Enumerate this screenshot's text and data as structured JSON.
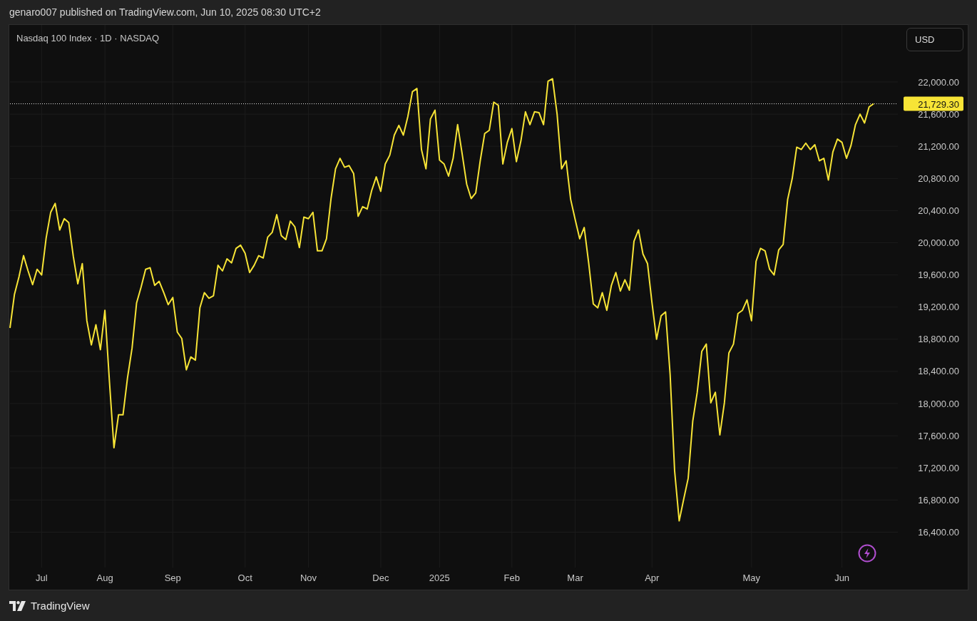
{
  "header": {
    "text": "genaro007 published on TradingView.com, Jun 10, 2025 08:30 UTC+2"
  },
  "chart": {
    "legend": "Nasdaq 100 Index · 1D · NASDAQ",
    "currency_button": "USD",
    "chart_data": {
      "type": "line",
      "categories": [
        null,
        null,
        null,
        null,
        null,
        null,
        null,
        "Jul",
        null,
        null,
        null,
        null,
        null,
        null,
        null,
        null,
        null,
        null,
        null,
        null,
        null,
        "Aug",
        null,
        null,
        null,
        null,
        null,
        null,
        null,
        null,
        null,
        null,
        null,
        null,
        null,
        null,
        "Sep",
        null,
        null,
        null,
        null,
        null,
        null,
        null,
        null,
        null,
        null,
        null,
        null,
        null,
        null,
        null,
        "Oct",
        null,
        null,
        null,
        null,
        null,
        null,
        null,
        null,
        null,
        null,
        null,
        null,
        null,
        "Nov",
        null,
        null,
        null,
        null,
        null,
        null,
        null,
        null,
        null,
        null,
        null,
        null,
        null,
        null,
        null,
        "Dec",
        null,
        null,
        null,
        null,
        null,
        null,
        null,
        null,
        null,
        null,
        null,
        null,
        "2025",
        null,
        null,
        null,
        null,
        null,
        null,
        null,
        null,
        null,
        null,
        null,
        null,
        null,
        null,
        null,
        "Feb",
        null,
        null,
        null,
        null,
        null,
        null,
        null,
        null,
        null,
        null,
        null,
        null,
        null,
        "Mar",
        null,
        null,
        null,
        null,
        null,
        null,
        null,
        null,
        null,
        null,
        null,
        null,
        null,
        null,
        null,
        null,
        "Apr",
        null,
        null,
        null,
        null,
        null,
        null,
        null,
        null,
        null,
        null,
        null,
        null,
        null,
        null,
        null,
        null,
        null,
        null,
        null,
        null,
        null,
        "May",
        null,
        null,
        null,
        null,
        null,
        null,
        null,
        null,
        null,
        null,
        null,
        null,
        null,
        null,
        null,
        null,
        null,
        null,
        null,
        "Jun",
        null,
        null,
        null,
        null,
        null,
        null,
        null
      ],
      "series": [
        {
          "color": "#f7e436",
          "values": [
            18940,
            19360,
            19580,
            19840,
            19650,
            19480,
            19670,
            19600,
            20060,
            20380,
            20490,
            20160,
            20300,
            20250,
            19830,
            19490,
            19740,
            19030,
            18730,
            18980,
            18670,
            19160,
            18270,
            17450,
            17860,
            17860,
            18320,
            18690,
            19250,
            19450,
            19670,
            19690,
            19470,
            19520,
            19380,
            19230,
            19320,
            18890,
            18810,
            18420,
            18580,
            18540,
            19190,
            19380,
            19310,
            19340,
            19720,
            19650,
            19800,
            19750,
            19930,
            19970,
            19870,
            19630,
            19720,
            19840,
            19810,
            20070,
            20130,
            20350,
            20090,
            20040,
            20270,
            20200,
            19940,
            20320,
            20300,
            20380,
            19900,
            19900,
            20050,
            20550,
            20920,
            21050,
            20940,
            20960,
            20860,
            20330,
            20450,
            20420,
            20650,
            20820,
            20640,
            20980,
            21090,
            21340,
            21460,
            21340,
            21570,
            21880,
            21920,
            21160,
            20920,
            21540,
            21650,
            21030,
            20980,
            20830,
            21050,
            21470,
            21110,
            20730,
            20550,
            20620,
            21020,
            21360,
            21400,
            21750,
            21710,
            20980,
            21250,
            21420,
            21010,
            21270,
            21630,
            21470,
            21630,
            21620,
            21470,
            22010,
            22040,
            21600,
            20920,
            21020,
            20540,
            20290,
            20050,
            20190,
            19740,
            19240,
            19190,
            19380,
            19160,
            19470,
            19630,
            19400,
            19540,
            19410,
            20020,
            20160,
            19860,
            19740,
            19250,
            18800,
            19090,
            19140,
            18360,
            17160,
            16540,
            16810,
            17070,
            17780,
            18140,
            18650,
            18740,
            18010,
            18140,
            17610,
            18010,
            18630,
            18740,
            19120,
            19160,
            19290,
            19030,
            19770,
            19930,
            19900,
            19670,
            19600,
            19910,
            19980,
            20540,
            20800,
            21190,
            21160,
            21240,
            21160,
            21220,
            21020,
            21050,
            20780,
            21130,
            21290,
            21250,
            21050,
            21210,
            21470,
            21600,
            21490,
            21690,
            21730
          ]
        }
      ],
      "ylim": [
        15960,
        22710
      ],
      "grid": true,
      "ref_lines": [
        {
          "axis": "y",
          "value": 21729.3,
          "label": "21,729.30"
        }
      ],
      "yticks": [
        {
          "value": 16400,
          "label": "16,400.00"
        },
        {
          "value": 16800,
          "label": "16,800.00"
        },
        {
          "value": 17200,
          "label": "17,200.00"
        },
        {
          "value": 17600,
          "label": "17,600.00"
        },
        {
          "value": 18000,
          "label": "18,000.00"
        },
        {
          "value": 18400,
          "label": "18,400.00"
        },
        {
          "value": 18800,
          "label": "18,800.00"
        },
        {
          "value": 19200,
          "label": "19,200.00"
        },
        {
          "value": 19600,
          "label": "19,600.00"
        },
        {
          "value": 20000,
          "label": "20,000.00"
        },
        {
          "value": 20400,
          "label": "20,400.00"
        },
        {
          "value": 20800,
          "label": "20,800.00"
        },
        {
          "value": 21200,
          "label": "21,200.00"
        },
        {
          "value": 21600,
          "label": "21,600.00"
        },
        {
          "value": 22000,
          "label": "22,000.00"
        }
      ]
    }
  },
  "footer": {
    "brand": "TradingView"
  }
}
